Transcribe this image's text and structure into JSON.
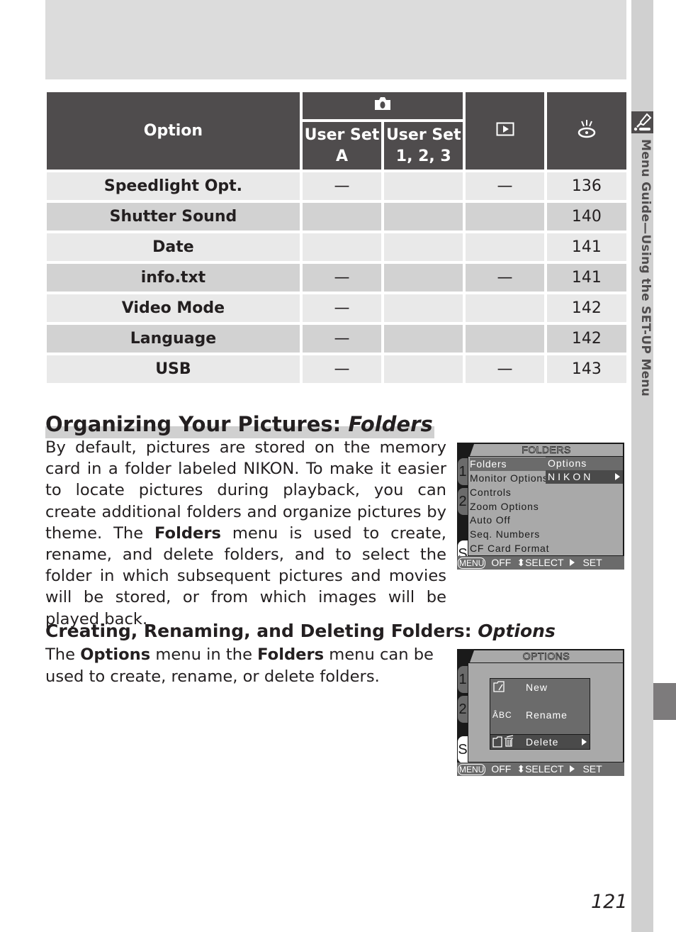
{
  "side_tab": {
    "icon": "wrench-setup-icon",
    "label": "Menu Guide—Using the SET-UP Menu"
  },
  "table": {
    "headers": {
      "option": "Option",
      "camera_group_icon": "camera-icon",
      "user_set_a": "User Set A",
      "user_set_a_line1": "User Set",
      "user_set_a_line2": "A",
      "user_set_123_line1": "User Set",
      "user_set_123_line2": "1, 2, 3",
      "playback_icon": "playback-icon",
      "page_icon": "eye-reference-icon"
    },
    "rows": [
      {
        "option": "Speedlight Opt.",
        "user_set_a": "—",
        "user_set_123": "",
        "playback": "—",
        "page": "136"
      },
      {
        "option": "Shutter Sound",
        "user_set_a": "",
        "user_set_123": "",
        "playback": "",
        "page": "140"
      },
      {
        "option": "Date",
        "user_set_a": "",
        "user_set_123": "",
        "playback": "",
        "page": "141"
      },
      {
        "option": "info.txt",
        "user_set_a": "—",
        "user_set_123": "",
        "playback": "—",
        "page": "141"
      },
      {
        "option": "Video Mode",
        "user_set_a": "—",
        "user_set_123": "",
        "playback": "",
        "page": "142"
      },
      {
        "option": "Language",
        "user_set_a": "—",
        "user_set_123": "",
        "playback": "",
        "page": "142"
      },
      {
        "option": "USB",
        "user_set_a": "—",
        "user_set_123": "",
        "playback": "—",
        "page": "143"
      }
    ]
  },
  "section1": {
    "heading_plain": "Organizing Your Pictures: ",
    "heading_italic": "Folders",
    "body_part1": "By default, pictures are stored on the memory card in a folder labeled NIKON. To make it easier to locate pictures during playback, you can create additional folders and organize pictures by theme. The ",
    "body_bold": "Folders",
    "body_part2": " menu is used to create, rename, and delete folders, and to select the folder in which subsequent pictures and movies will be stored, or from which images will be played back."
  },
  "section2": {
    "heading_plain": "Creating, Renaming, and Deleting Folders: ",
    "heading_italic": "Options",
    "body_t1": "The ",
    "body_b1": "Options",
    "body_t2": " menu in the ",
    "body_b2": "Folders",
    "body_t3": " menu can be used to create, rename, or delete folders."
  },
  "screen_folders": {
    "title": "FOLDERS",
    "tabs": [
      "1",
      "2",
      "S"
    ],
    "items": [
      "Folders",
      "Monitor Options",
      "Controls",
      "Zoom Options",
      "Auto Off",
      "Seq. Numbers",
      "CF Card Format"
    ],
    "selected_item": "Folders",
    "submenu_header": "Options",
    "submenu_value": "NIKON",
    "footer": {
      "menu": "MENU",
      "off": "OFF",
      "select": "⬍SELECT",
      "set": "SET"
    }
  },
  "screen_options": {
    "title": "OPTIONS",
    "tabs": [
      "1",
      "2",
      "S"
    ],
    "items": [
      {
        "icon": "new-folder-icon",
        "icon_text": "□⁄",
        "label": "New"
      },
      {
        "icon": "rename-abc-icon",
        "icon_text": "ÂBC",
        "label": "Rename"
      },
      {
        "icon": "delete-folder-trash-icon",
        "icon_text": "□ 🗑",
        "label": "Delete"
      }
    ],
    "selected_item": "Delete",
    "footer": {
      "menu": "MENU",
      "off": "OFF",
      "select": "⬍SELECT",
      "set": "SET"
    }
  },
  "page_number": "121"
}
